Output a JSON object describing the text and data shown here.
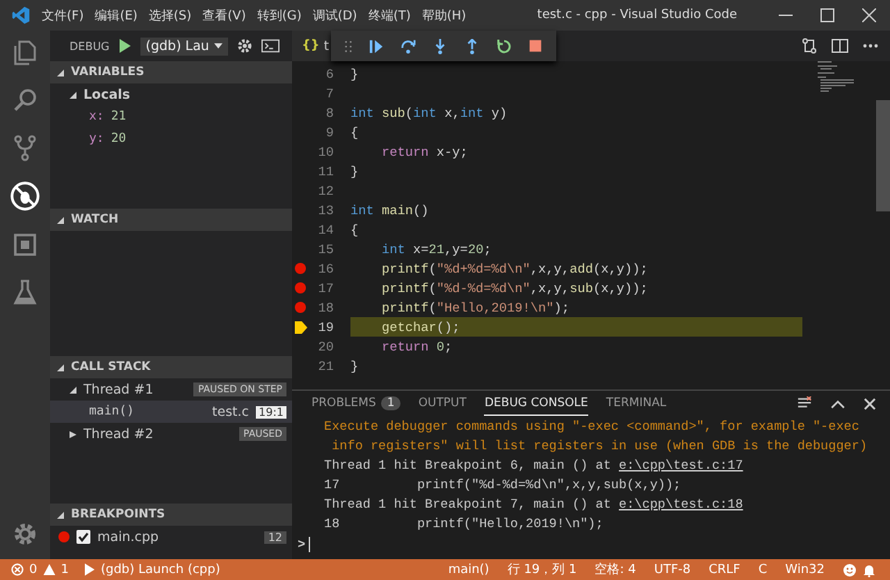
{
  "title_bar": {
    "menus": [
      "文件(F)",
      "编辑(E)",
      "选择(S)",
      "查看(V)",
      "转到(G)",
      "调试(D)",
      "终端(T)",
      "帮助(H)"
    ],
    "title": "test.c - cpp - Visual Studio Code"
  },
  "debug_header": {
    "label": "DEBUG",
    "configuration": "(gdb) Lau"
  },
  "editor_tab": {
    "icon": "{}",
    "label": "t"
  },
  "sidebar": {
    "variables": {
      "title": "VARIABLES",
      "expanded": true,
      "scopes": [
        {
          "label": "Locals",
          "expanded": true,
          "items": [
            {
              "name": "x:",
              "value": "21"
            },
            {
              "name": "y:",
              "value": "20"
            }
          ]
        }
      ]
    },
    "watch": {
      "title": "WATCH",
      "expanded": true
    },
    "call_stack": {
      "title": "CALL STACK",
      "expanded": true,
      "threads": [
        {
          "label": "Thread #1",
          "status": "PAUSED ON STEP",
          "expanded": true,
          "frames": [
            {
              "name": "main()",
              "file": "test.c",
              "position": "19:1",
              "selected": true
            }
          ]
        },
        {
          "label": "Thread #2",
          "status": "PAUSED",
          "expanded": false
        }
      ]
    },
    "breakpoints": {
      "title": "BREAKPOINTS",
      "expanded": true,
      "items": [
        {
          "label": "main.cpp",
          "checked": true,
          "count": "12"
        }
      ]
    }
  },
  "code_lines": [
    {
      "number": "6",
      "breakpoint": false,
      "current": false,
      "tokens": [
        {
          "kind": "plain",
          "text": "}"
        }
      ]
    },
    {
      "number": "7",
      "breakpoint": false,
      "current": false
    },
    {
      "number": "8",
      "breakpoint": false,
      "current": false,
      "tokens": [
        {
          "kind": "keyword",
          "text": "int"
        },
        {
          "kind": "function",
          "text": " sub"
        },
        {
          "kind": "plain",
          "text": "("
        },
        {
          "kind": "keyword",
          "text": "int"
        },
        {
          "kind": "plain",
          "text": " x,"
        },
        {
          "kind": "keyword",
          "text": "int"
        },
        {
          "kind": "plain",
          "text": " y)"
        }
      ]
    },
    {
      "number": "9",
      "breakpoint": false,
      "current": false,
      "tokens": [
        {
          "kind": "plain",
          "text": "{"
        }
      ]
    },
    {
      "number": "10",
      "breakpoint": false,
      "current": false,
      "tokens": [
        {
          "kind": "control",
          "text": "    return"
        },
        {
          "kind": "plain",
          "text": " x-y;"
        }
      ]
    },
    {
      "number": "11",
      "breakpoint": false,
      "current": false,
      "tokens": [
        {
          "kind": "plain",
          "text": "}"
        }
      ]
    },
    {
      "number": "12",
      "breakpoint": false,
      "current": false
    },
    {
      "number": "13",
      "breakpoint": false,
      "current": false,
      "tokens": [
        {
          "kind": "keyword",
          "text": "int"
        },
        {
          "kind": "function",
          "text": " main"
        },
        {
          "kind": "plain",
          "text": "()"
        }
      ]
    },
    {
      "number": "14",
      "breakpoint": false,
      "current": false,
      "tokens": [
        {
          "kind": "plain",
          "text": "{"
        }
      ]
    },
    {
      "number": "15",
      "breakpoint": false,
      "current": false,
      "tokens": [
        {
          "kind": "keyword",
          "text": "    int"
        },
        {
          "kind": "plain",
          "text": " x="
        },
        {
          "kind": "number",
          "text": "21"
        },
        {
          "kind": "plain",
          "text": ",y="
        },
        {
          "kind": "number",
          "text": "20"
        },
        {
          "kind": "plain",
          "text": ";"
        }
      ]
    },
    {
      "number": "16",
      "breakpoint": true,
      "current": false,
      "tokens": [
        {
          "kind": "function",
          "text": "    printf"
        },
        {
          "kind": "plain",
          "text": "("
        },
        {
          "kind": "string",
          "text": "\"%d+%d=%d\\n\""
        },
        {
          "kind": "plain",
          "text": ",x,y,"
        },
        {
          "kind": "function",
          "text": "add"
        },
        {
          "kind": "plain",
          "text": "(x,y));"
        }
      ]
    },
    {
      "number": "17",
      "breakpoint": true,
      "current": false,
      "tokens": [
        {
          "kind": "function",
          "text": "    printf"
        },
        {
          "kind": "plain",
          "text": "("
        },
        {
          "kind": "string",
          "text": "\"%d-%d=%d\\n\""
        },
        {
          "kind": "plain",
          "text": ",x,y,"
        },
        {
          "kind": "function",
          "text": "sub"
        },
        {
          "kind": "plain",
          "text": "(x,y));"
        }
      ]
    },
    {
      "number": "18",
      "breakpoint": true,
      "current": false,
      "tokens": [
        {
          "kind": "function",
          "text": "    printf"
        },
        {
          "kind": "plain",
          "text": "("
        },
        {
          "kind": "string",
          "text": "\"Hello,2019!\\n\""
        },
        {
          "kind": "plain",
          "text": ");"
        }
      ]
    },
    {
      "number": "19",
      "breakpoint": false,
      "current": true,
      "tokens": [
        {
          "kind": "function",
          "text": "    getchar"
        },
        {
          "kind": "plain",
          "text": "();"
        }
      ]
    },
    {
      "number": "20",
      "breakpoint": false,
      "current": false,
      "tokens": [
        {
          "kind": "control",
          "text": "    return"
        },
        {
          "kind": "number",
          "text": " 0"
        },
        {
          "kind": "plain",
          "text": ";"
        }
      ]
    },
    {
      "number": "21",
      "breakpoint": false,
      "current": false,
      "tokens": [
        {
          "kind": "plain",
          "text": "}"
        }
      ]
    }
  ],
  "panel": {
    "tabs": [
      {
        "label": "PROBLEMS",
        "badge": "1",
        "selected": false
      },
      {
        "label": "OUTPUT",
        "selected": false
      },
      {
        "label": "DEBUG CONSOLE",
        "selected": true
      },
      {
        "label": "TERMINAL",
        "selected": false
      }
    ],
    "console_lines": [
      {
        "kind": "info",
        "text": "Execute debugger commands using \"-exec <command>\", for example \"-exec"
      },
      {
        "kind": "info",
        "text": " info registers\" will list registers in use (when GDB is the debugger)"
      },
      {
        "kind": "log",
        "text": "Thread 1 hit Breakpoint 6, main () at ",
        "link": "e:\\cpp\\test.c:17"
      },
      {
        "kind": "log",
        "text": "17          printf(\"%d-%d=%d\\n\",x,y,sub(x,y));"
      },
      {
        "kind": "log",
        "text": "Thread 1 hit Breakpoint 7, main () at ",
        "link": "e:\\cpp\\test.c:18"
      },
      {
        "kind": "log",
        "text": "18          printf(\"Hello,2019!\\n\");"
      }
    ],
    "prompt": ">"
  },
  "status_bar": {
    "errors": "0",
    "warnings": "1",
    "launch": "(gdb) Launch (cpp)",
    "right": [
      "main()",
      "行 19，列 1",
      "空格: 4",
      "UTF-8",
      "CRLF",
      "C",
      "Win32"
    ]
  }
}
